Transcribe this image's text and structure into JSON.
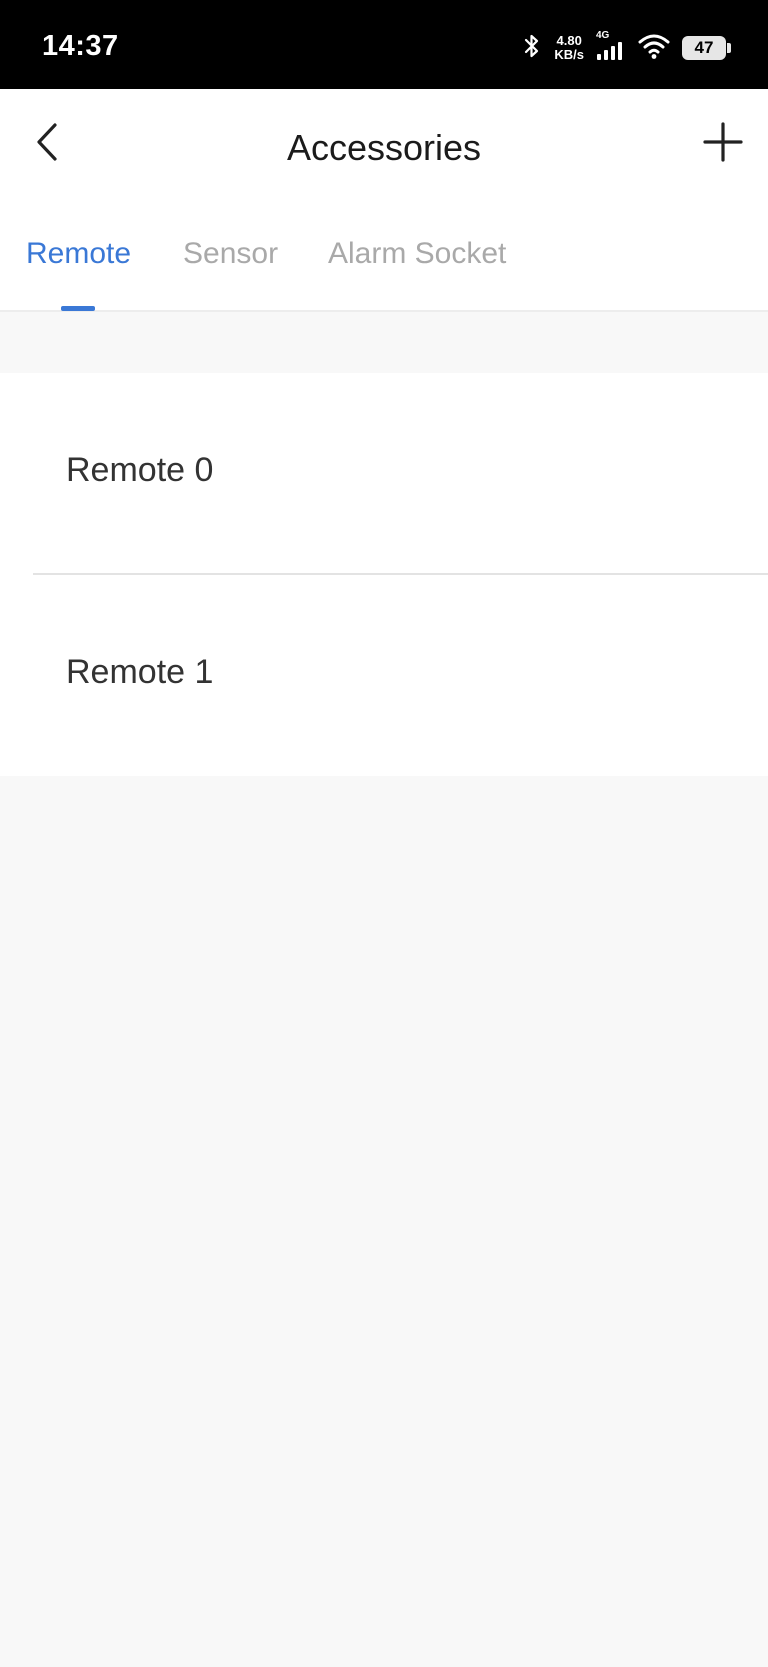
{
  "status_bar": {
    "time": "14:37",
    "net_speed_value": "4.80",
    "net_speed_unit": "KB/s",
    "network_type": "4G",
    "battery": "47",
    "icons": [
      "bluetooth-icon",
      "signal-icon",
      "wifi-icon",
      "battery-icon"
    ]
  },
  "header": {
    "title": "Accessories",
    "back_icon": "chevron-left-icon",
    "add_icon": "plus-icon"
  },
  "tabs": [
    {
      "label": "Remote",
      "active": true
    },
    {
      "label": "Sensor",
      "active": false
    },
    {
      "label": "Alarm Socket",
      "active": false
    }
  ],
  "list": {
    "items": [
      {
        "label": "Remote 0"
      },
      {
        "label": "Remote 1"
      }
    ]
  },
  "colors": {
    "accent": "#3a78d6",
    "background": "#f8f8f8",
    "inactive_tab": "#a9a9a9"
  }
}
